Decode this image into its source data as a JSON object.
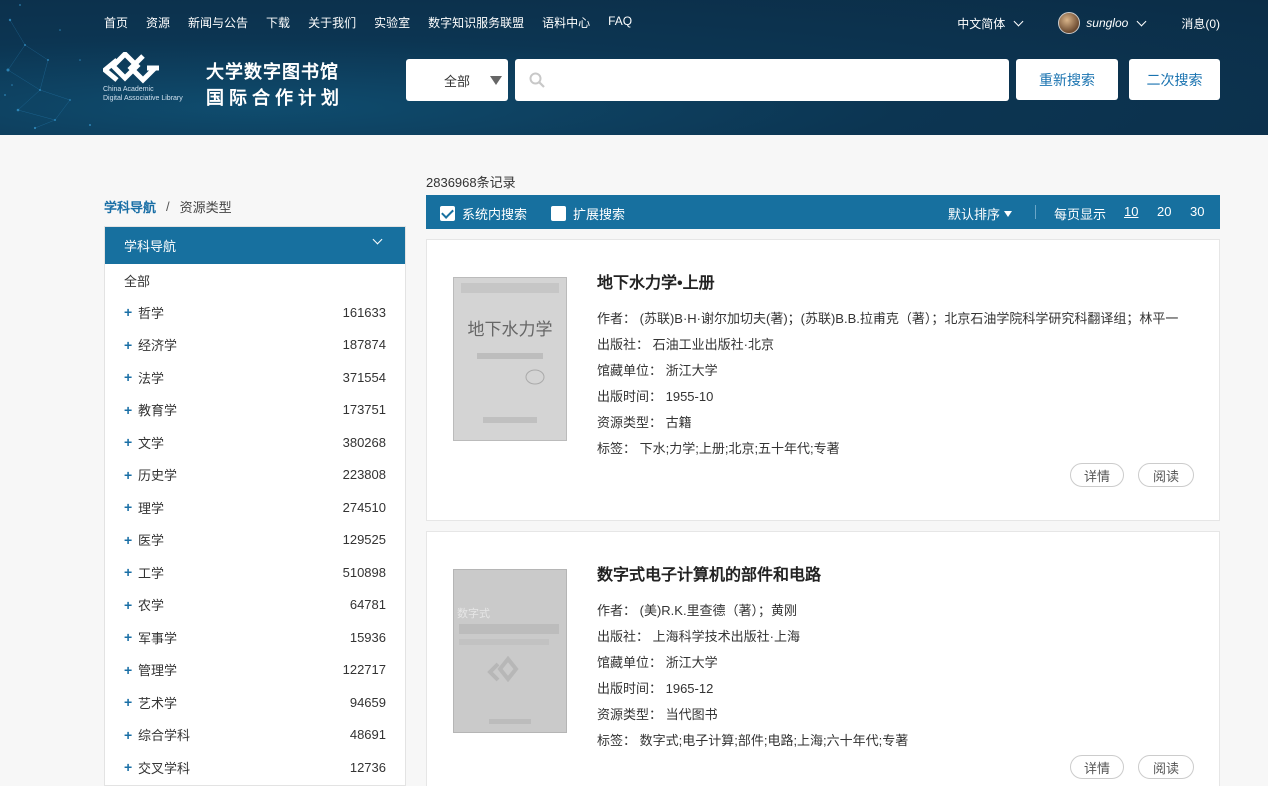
{
  "topnav": [
    "首页",
    "资源",
    "新闻与公告",
    "下载",
    "关于我们",
    "实验室",
    "数字知识服务联盟",
    "语料中心",
    "FAQ"
  ],
  "header": {
    "language": "中文简体",
    "username": "sungloo",
    "messages": "消息(0)",
    "logo_en_line1": "China Academic",
    "logo_en_line2": "Digital Associative Library",
    "logo_title_line1": "大学数字图书馆",
    "logo_title_line2": "国际合作计划"
  },
  "search": {
    "scope": "全部",
    "query": "",
    "placeholder": "",
    "btn_research": "重新搜索",
    "btn_second": "二次搜索"
  },
  "breadcrumb": {
    "active": "学科导航",
    "separator": "/",
    "other": "资源类型"
  },
  "sidebar": {
    "header": "学科导航",
    "all": "全部",
    "items": [
      {
        "label": "哲学",
        "count": "161633"
      },
      {
        "label": "经济学",
        "count": "187874"
      },
      {
        "label": "法学",
        "count": "371554"
      },
      {
        "label": "教育学",
        "count": "173751"
      },
      {
        "label": "文学",
        "count": "380268"
      },
      {
        "label": "历史学",
        "count": "223808"
      },
      {
        "label": "理学",
        "count": "274510"
      },
      {
        "label": "医学",
        "count": "129525"
      },
      {
        "label": "工学",
        "count": "510898"
      },
      {
        "label": "农学",
        "count": "64781"
      },
      {
        "label": "军事学",
        "count": "15936"
      },
      {
        "label": "管理学",
        "count": "122717"
      },
      {
        "label": "艺术学",
        "count": "94659"
      },
      {
        "label": "综合学科",
        "count": "48691"
      },
      {
        "label": "交叉学科",
        "count": "12736"
      }
    ]
  },
  "results": {
    "count_text": "2836968条记录",
    "toolbar": {
      "in_system": "系统内搜索",
      "in_system_checked": true,
      "extended": "扩展搜索",
      "extended_checked": false,
      "sort": "默认排序",
      "per_page_label": "每页显示",
      "sizes": [
        "10",
        "20",
        "30"
      ],
      "active_size": "10"
    },
    "items": [
      {
        "title": "地下水力学•上册",
        "cover_title": "地下水力学",
        "author": "作者： (苏联)B·H·谢尔加切夫(著)；(苏联)B.B.拉甫克（著）；北京石油学院科学研究科翻译组；林平一",
        "publisher": "出版社： 石油工业出版社·北京",
        "holder": "馆藏单位： 浙江大学",
        "date": "出版时间： 1955-10",
        "type": "资源类型： 古籍",
        "tags": "标签： 下水;力学;上册;北京;五十年代;专著",
        "detail": "详情",
        "read": "阅读"
      },
      {
        "title": "数字式电子计算机的部件和电路",
        "cover_title": "数字式",
        "author": "作者： (美)R.K.里查德（著）；黄刚",
        "publisher": "出版社： 上海科学技术出版社·上海",
        "holder": "馆藏单位： 浙江大学",
        "date": "出版时间： 1965-12",
        "type": "资源类型： 当代图书",
        "tags": "标签： 数字式;电子计算;部件;电路;上海;六十年代;专著",
        "detail": "详情",
        "read": "阅读"
      }
    ]
  },
  "colors": {
    "header_bg": "#0c3552",
    "accent": "#17709f",
    "link": "#1a6fa6"
  }
}
